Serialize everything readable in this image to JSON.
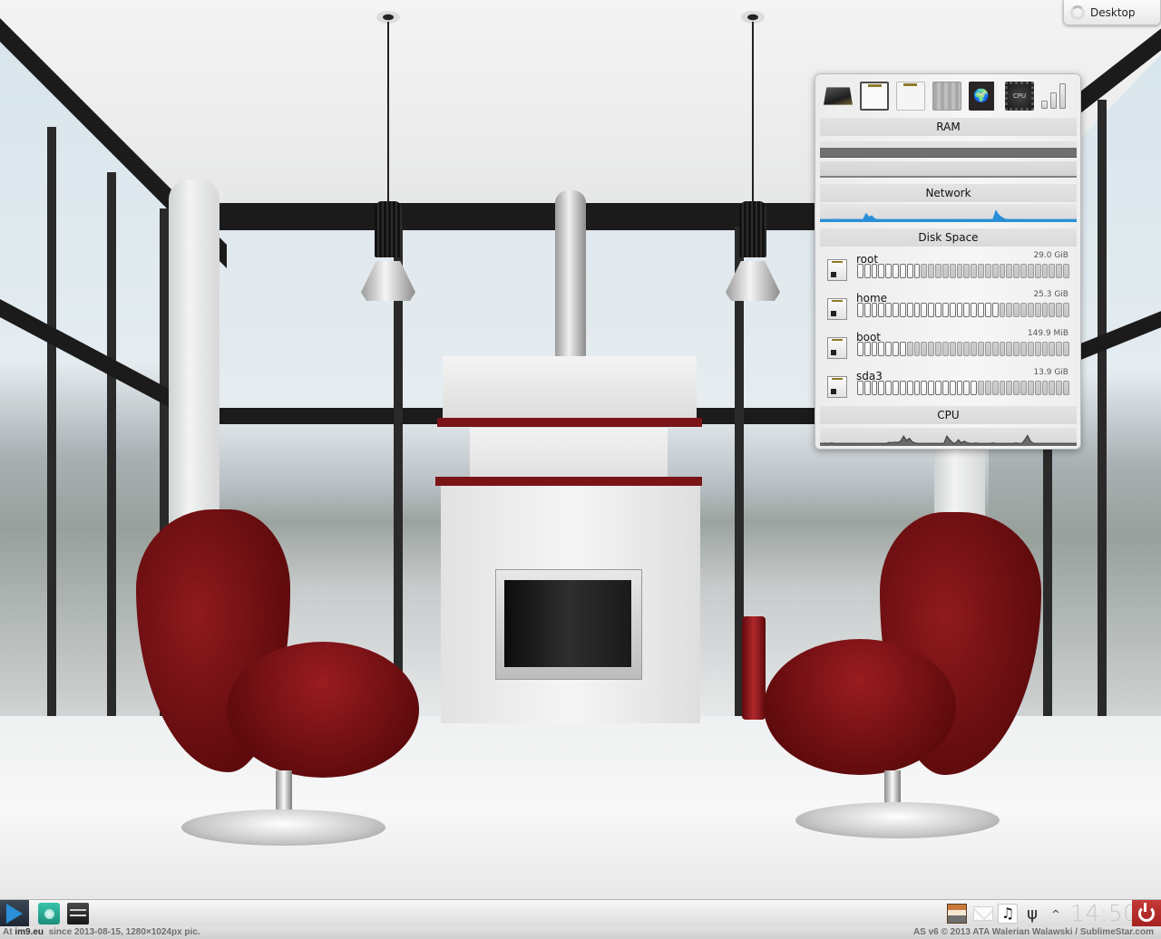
{
  "desktop_button": {
    "label": "Desktop",
    "icon": "spinner-icon"
  },
  "system_monitor": {
    "toolbar": [
      {
        "name": "cpu-chip-icon"
      },
      {
        "name": "disk-monitor-icon"
      },
      {
        "name": "disk-monitor-inactive-icon"
      },
      {
        "name": "ram-icon"
      },
      {
        "name": "network-globe-icon"
      },
      {
        "name": "cpu-processor-icon",
        "text": "CPU"
      },
      {
        "name": "signal-bars-icon"
      }
    ],
    "sections": {
      "ram": "RAM",
      "network": "Network",
      "disk_space": "Disk Space",
      "cpu": "CPU"
    },
    "ram": {
      "used_fraction": 0.6
    },
    "network_series": [
      0.05,
      0.05,
      0.05,
      0.05,
      0.05,
      0.05,
      0.06,
      0.05,
      0.05,
      0.05,
      0.05,
      0.05,
      0.05,
      0.05,
      0.05,
      0.05,
      0.45,
      0.2,
      0.3,
      0.08,
      0.05,
      0.05,
      0.05,
      0.05,
      0.05,
      0.05,
      0.05,
      0.05,
      0.05,
      0.05,
      0.05,
      0.05,
      0.05,
      0.05,
      0.05,
      0.05,
      0.05,
      0.05,
      0.05,
      0.05,
      0.05,
      0.05,
      0.05,
      0.05,
      0.05,
      0.05,
      0.05,
      0.05,
      0.05,
      0.05,
      0.05,
      0.05,
      0.05,
      0.05,
      0.05,
      0.05,
      0.05,
      0.05,
      0.05,
      0.05,
      0.05,
      0.65,
      0.35,
      0.2,
      0.08,
      0.05,
      0.05,
      0.05,
      0.05,
      0.05,
      0.05,
      0.05,
      0.05,
      0.05,
      0.05,
      0.05,
      0.05,
      0.05,
      0.05,
      0.05,
      0.05,
      0.05,
      0.05,
      0.05,
      0.05,
      0.05,
      0.05,
      0.05,
      0.05,
      0.05
    ],
    "cpu_series": [
      0.05,
      0.05,
      0.06,
      0.05,
      0.08,
      0.05,
      0.05,
      0.05,
      0.05,
      0.05,
      0.05,
      0.05,
      0.05,
      0.05,
      0.05,
      0.05,
      0.05,
      0.05,
      0.05,
      0.05,
      0.05,
      0.05,
      0.05,
      0.05,
      0.12,
      0.1,
      0.14,
      0.12,
      0.2,
      0.55,
      0.25,
      0.4,
      0.15,
      0.08,
      0.05,
      0.05,
      0.05,
      0.05,
      0.05,
      0.05,
      0.05,
      0.05,
      0.05,
      0.05,
      0.55,
      0.3,
      0.1,
      0.05,
      0.3,
      0.08,
      0.2,
      0.1,
      0.05,
      0.05,
      0.08,
      0.05,
      0.05,
      0.05,
      0.05,
      0.05,
      0.08,
      0.05,
      0.05,
      0.05,
      0.05,
      0.05,
      0.05,
      0.05,
      0.08,
      0.05,
      0.05,
      0.3,
      0.6,
      0.2,
      0.05,
      0.05,
      0.05,
      0.05,
      0.05,
      0.05,
      0.05,
      0.05,
      0.05,
      0.05,
      0.05,
      0.05,
      0.05,
      0.05,
      0.05,
      0.05
    ],
    "disks": [
      {
        "name": "root",
        "size": "29.0 GiB",
        "used_fraction": 0.3
      },
      {
        "name": "home",
        "size": "25.3 GiB",
        "used_fraction": 0.67
      },
      {
        "name": "boot",
        "size": "149.9 MiB",
        "used_fraction": 0.23
      },
      {
        "name": "sda3",
        "size": "13.9 GiB",
        "used_fraction": 0.57
      }
    ],
    "colors": {
      "network_line": "#2a8fd8",
      "network_base": "#a6d86e",
      "cpu_fill": "#6a6a6a"
    }
  },
  "taskbar": {
    "start_icon": "play-triangle-icon",
    "launchers": [
      {
        "name": "teal-app-icon"
      },
      {
        "name": "file-drawer-icon"
      }
    ],
    "tray": [
      {
        "name": "notes-applet-icon"
      },
      {
        "name": "mail-icon"
      },
      {
        "name": "music-icon",
        "glyph": "♫"
      },
      {
        "name": "usb-icon",
        "glyph": "ψ"
      },
      {
        "name": "expand-tray-icon",
        "glyph": "^"
      }
    ],
    "clock": "14:50",
    "power_icon": "power-icon",
    "power_color": "#b52a27"
  },
  "watermark": {
    "left_prefix": "At ",
    "left_site": "im9.eu",
    "left_suffix": "  since 2013-08-15, 1280×1024px pic.",
    "right": "AS v6 © 2013 ATA Walerian Walawski / SublimeStar.com"
  }
}
